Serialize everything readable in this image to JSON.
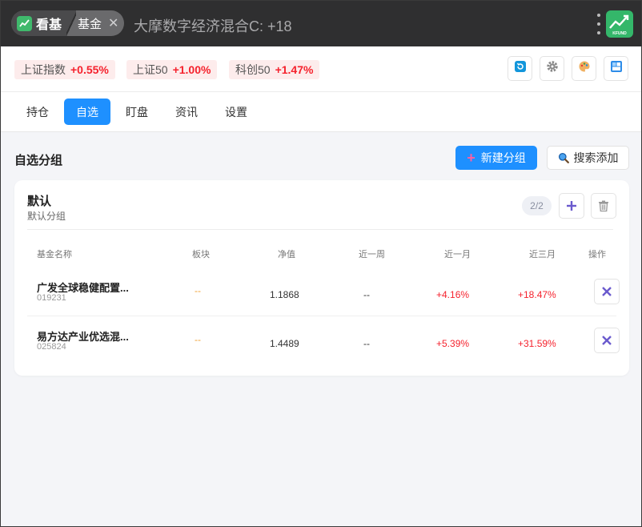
{
  "titlebar": {
    "app_label": "看基",
    "app_icon": "chart-icon",
    "fund_tab_label": "基金",
    "close_glyph": "✕",
    "window_title": "大摩数字经济混合C: +18",
    "brand_badge_label": "KFUND",
    "brand_color": "#34b76a"
  },
  "indices": [
    {
      "name": "上证指数",
      "change": "+0.55%"
    },
    {
      "name": "上证50",
      "change": "+1.00%"
    },
    {
      "name": "科创50",
      "change": "+1.47%"
    }
  ],
  "toolbar_icons": [
    "refresh-icon",
    "gear-icon",
    "palette-icon",
    "layout-icon"
  ],
  "tabs": [
    {
      "label": "持仓",
      "active": false
    },
    {
      "label": "自选",
      "active": true
    },
    {
      "label": "盯盘",
      "active": false
    },
    {
      "label": "资讯",
      "active": false
    },
    {
      "label": "设置",
      "active": false
    }
  ],
  "section": {
    "title": "自选分组",
    "new_group_label": "新建分组",
    "search_add_label": "搜索添加"
  },
  "group": {
    "name": "默认",
    "desc": "默认分组",
    "count": "2/2"
  },
  "table": {
    "headers": [
      "基金名称",
      "板块",
      "净值",
      "近一周",
      "近一月",
      "近三月",
      "操作"
    ],
    "rows": [
      {
        "name": "广发全球稳健配置...",
        "code": "019231",
        "sector": "--",
        "nav": "1.1868",
        "week": "--",
        "month": "+4.16%",
        "quarter": "+18.47%"
      },
      {
        "name": "易方达产业优选混...",
        "code": "025824",
        "sector": "--",
        "nav": "1.4489",
        "week": "--",
        "month": "+5.39%",
        "quarter": "+31.59%"
      }
    ]
  },
  "colors": {
    "accent": "#1e90ff",
    "up": "#f5222d",
    "sector": "#f0a030",
    "action": "#6a5acd"
  }
}
